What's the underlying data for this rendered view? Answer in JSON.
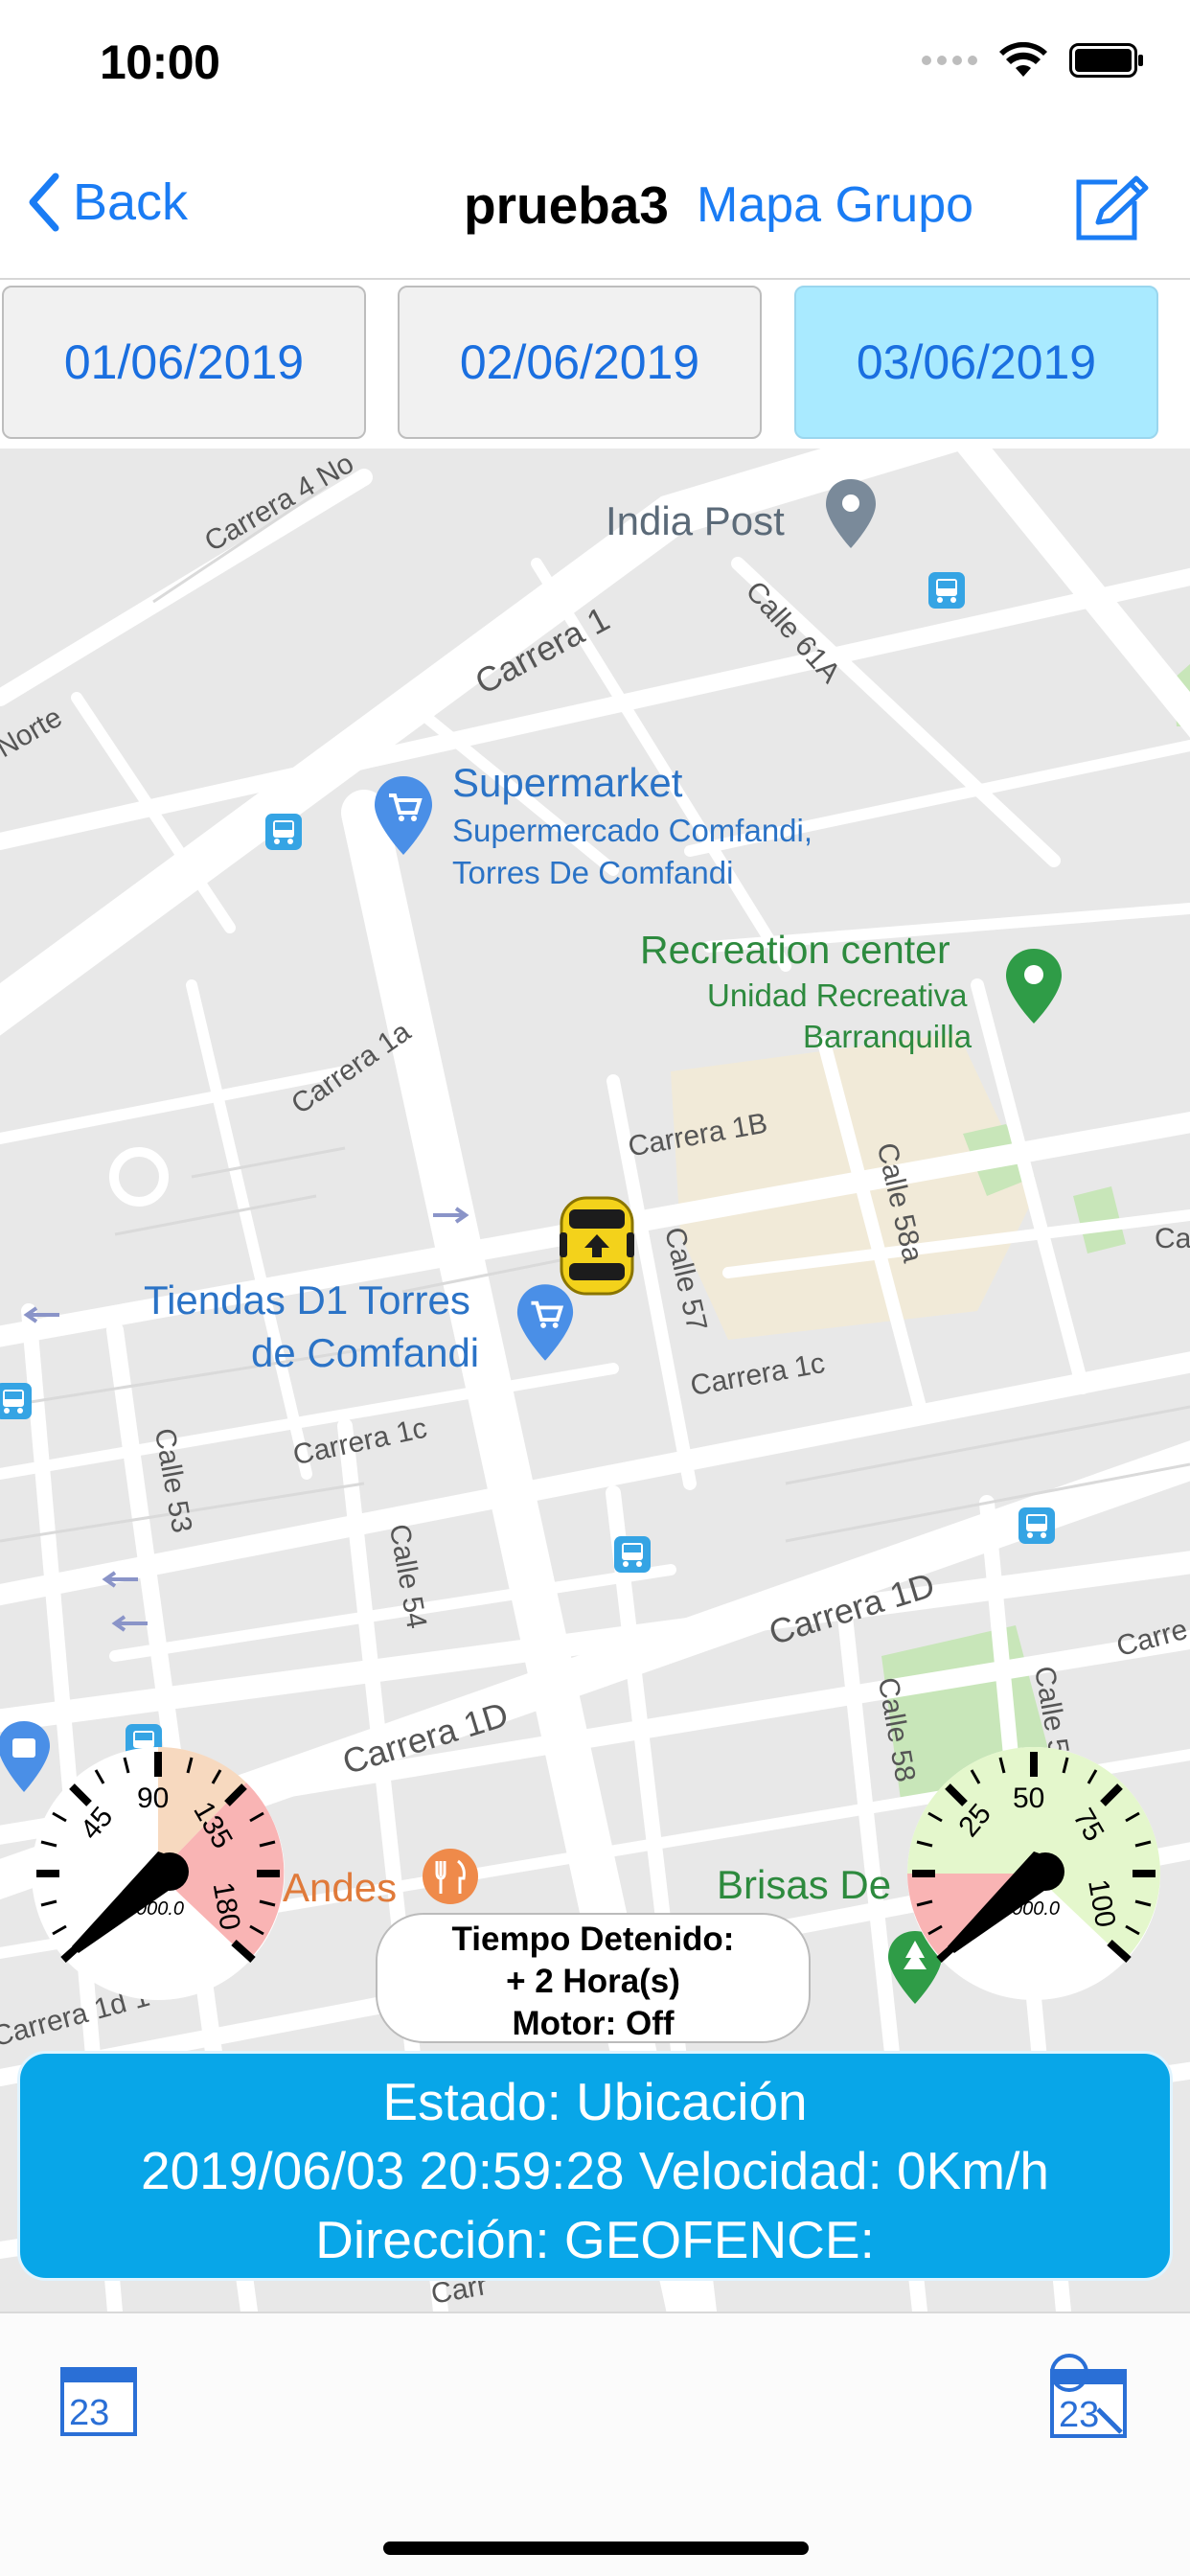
{
  "status_bar": {
    "time": "10:00"
  },
  "nav": {
    "back_label": "Back",
    "title": "prueba3",
    "group_link": "Mapa Grupo"
  },
  "dates": [
    {
      "label": "01/06/2019",
      "selected": false
    },
    {
      "label": "02/06/2019",
      "selected": false
    },
    {
      "label": "03/06/2019",
      "selected": true
    }
  ],
  "map": {
    "pois": {
      "india_post": "India Post",
      "supermarket_title": "Supermarket",
      "supermarket_line1": "Supermercado Comfandi,",
      "supermarket_line2": "Torres De Comfandi",
      "recreation_title": "Recreation center",
      "recreation_line1": "Unidad Recreativa",
      "recreation_line2": "Barranquilla",
      "tiendas_line1": "Tiendas D1 Torres",
      "tiendas_line2": "de Comfandi",
      "andes": "Andes",
      "brisas": "Brisas De"
    },
    "streets": {
      "carrera_4_norte": "Carrera 4 No",
      "norte": "Norte",
      "carrera_1": "Carrera 1",
      "calle_61a": "Calle 61A",
      "carrera_1a": "Carrera 1a",
      "carrera_1b": "Carrera 1B",
      "calle_58a": "Calle 58a",
      "calle_57": "Calle 57",
      "carrera_1c_right": "Carrera 1c",
      "carrera_1c_left": "Carrera 1c",
      "calle_53": "Calle 53",
      "calle_54": "Calle 54",
      "carrera_1d_right": "Carrera 1D",
      "carrera_1d_left": "Carrera 1D",
      "calle_58": "Calle 58",
      "calle_5x": "Calle 5",
      "carrera_1d1": "Carrera 1d 1",
      "carre_right": "Carre",
      "ca_edge": "Ca",
      "carr_bottom": "Carr"
    }
  },
  "gauges": {
    "left": {
      "ticks": [
        "45",
        "90",
        "135",
        "180"
      ],
      "odometer": "000.0"
    },
    "right": {
      "ticks": [
        "25",
        "50",
        "75",
        "100"
      ],
      "odometer": "000.0"
    }
  },
  "stop_box": {
    "line1": "Tiempo Detenido:",
    "line2": "+ 2 Hora(s)",
    "line3": "Motor: Off"
  },
  "info": {
    "line1": "Estado: Ubicación",
    "line2": "2019/06/03 20:59:28 Velocidad: 0Km/h",
    "line3": "Dirección:  GEOFENCE:"
  },
  "toolbar": {
    "left_icon_day": "23",
    "right_icon_day": "23"
  },
  "colors": {
    "accent": "#1a7cf4",
    "banner": "#08a6e8",
    "active_date": "#a9eaff",
    "poi_green": "#2d8a3e",
    "poi_blue": "#2b73c6"
  }
}
